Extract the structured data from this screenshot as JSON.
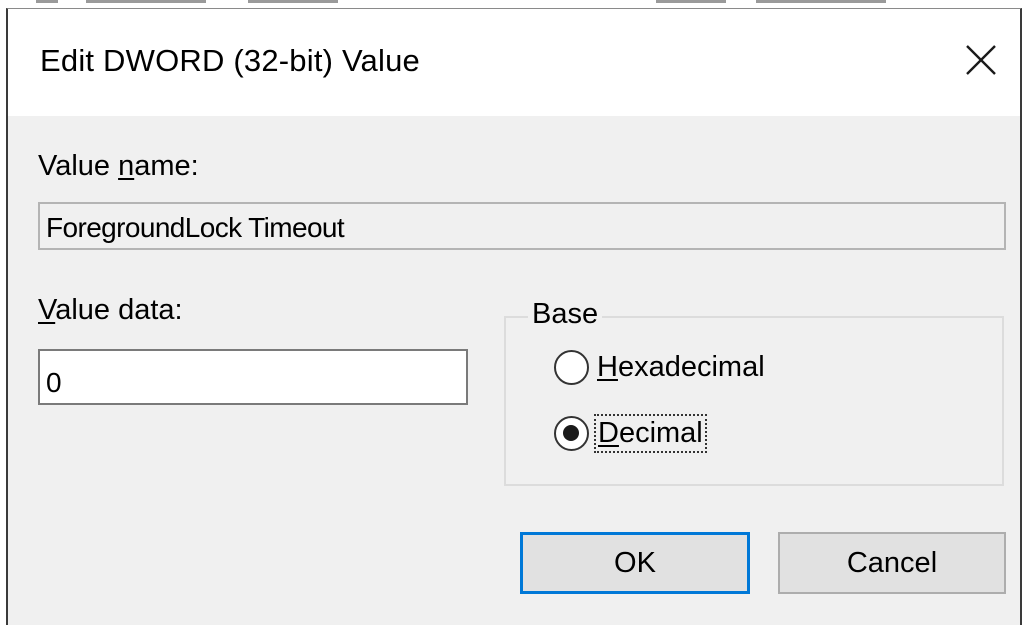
{
  "dialog": {
    "title": "Edit DWORD (32-bit) Value",
    "close_icon": "close-icon"
  },
  "value_name": {
    "label_pre": "Value ",
    "label_mnemonic": "n",
    "label_post": "ame:",
    "value": "ForegroundLock Timeout"
  },
  "value_data": {
    "label_mnemonic": "V",
    "label_post": "alue data:",
    "value": "0"
  },
  "base": {
    "legend": "Base",
    "options": [
      {
        "mnemonic": "H",
        "rest": "exadecimal",
        "selected": false
      },
      {
        "mnemonic": "D",
        "rest": "ecimal",
        "selected": true
      }
    ]
  },
  "buttons": {
    "ok_label": "OK",
    "cancel_label": "Cancel"
  },
  "colors": {
    "dialog_bg": "#f0f0f0",
    "title_bg": "#ffffff",
    "focus_accent": "#0078d7",
    "button_bg": "#e1e1e1"
  }
}
